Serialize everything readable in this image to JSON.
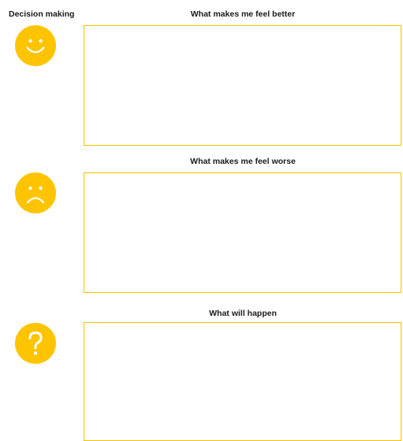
{
  "page": {
    "title": "Decision making"
  },
  "sections": [
    {
      "heading": "What makes me feel better",
      "icon": "smiley-face-icon"
    },
    {
      "heading": "What makes me feel worse",
      "icon": "sad-face-icon"
    },
    {
      "heading": "What will happen",
      "icon": "question-mark-icon"
    }
  ],
  "colors": {
    "accent": "#ffc400",
    "box_border": "#f3c300"
  }
}
